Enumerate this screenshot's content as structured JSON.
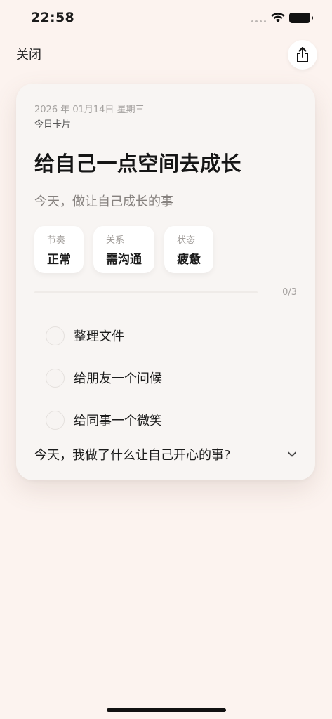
{
  "status_bar": {
    "time": "22:58"
  },
  "nav": {
    "close_label": "关闭",
    "share_icon": "share-icon"
  },
  "card": {
    "date": "2026 年 01月14日 星期三",
    "kind": "今日卡片",
    "title": "给自己一点空间去成长",
    "subtitle": "今天，做让自己成长的事",
    "tags": [
      {
        "label": "节奏",
        "value": "正常"
      },
      {
        "label": "关系",
        "value": "需沟通"
      },
      {
        "label": "状态",
        "value": "疲惫"
      }
    ],
    "progress": {
      "text": "0/3",
      "done": 0,
      "total": 3
    },
    "tasks": [
      {
        "label": "整理文件",
        "checked": false
      },
      {
        "label": "给朋友一个问候",
        "checked": false
      },
      {
        "label": "给同事一个微笑",
        "checked": false
      }
    ],
    "question": "今天，我做了什么让自己开心的事?"
  },
  "colors": {
    "background": "#fcf3ef",
    "card": "#f8f5f3",
    "text": "#1c1c1c",
    "muted": "#a3a09e"
  }
}
